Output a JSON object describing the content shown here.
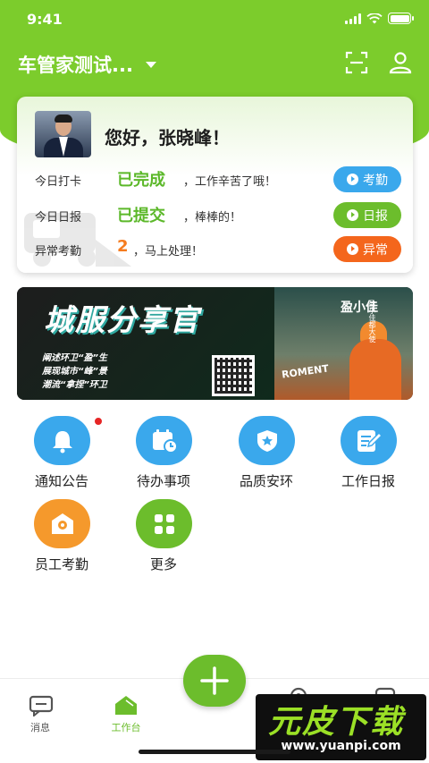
{
  "status_bar": {
    "time": "9:41"
  },
  "header": {
    "company": "车管家测试..."
  },
  "card": {
    "greeting": "您好，张晓峰！",
    "rows": [
      {
        "label": "今日打卡",
        "value": "已完成",
        "note": "，工作辛苦了哦！",
        "button": "考勤",
        "color": "#3aa8ec"
      },
      {
        "label": "今日日报",
        "value": "已提交",
        "note": "，棒棒的！",
        "button": "日报",
        "color": "#6cbd2c"
      },
      {
        "label": "异常考勤",
        "value": "2",
        "note": "，马上处理！",
        "button": "异常",
        "color": "#f4661c"
      }
    ]
  },
  "banner": {
    "title": "城服分享官",
    "bullets": [
      "阐述环卫“盈”生",
      "展现城市“峰”景",
      "潮流“拿捏”环卫"
    ],
    "name": "盈小佳",
    "sub": "盈小佳都大使",
    "brand": "ROMENT"
  },
  "grid": [
    {
      "label": "通知公告",
      "icon": "bell-icon",
      "color": "#3aa8ec",
      "badge": true
    },
    {
      "label": "待办事项",
      "icon": "calendar-clock-icon",
      "color": "#3aa8ec"
    },
    {
      "label": "品质安环",
      "icon": "shield-star-icon",
      "color": "#3aa8ec"
    },
    {
      "label": "工作日报",
      "icon": "edit-report-icon",
      "color": "#3aa8ec"
    },
    {
      "label": "员工考勤",
      "icon": "location-pin-icon",
      "color": "#f5992c"
    },
    {
      "label": "更多",
      "icon": "apps-grid-icon",
      "color": "#6cbd2c"
    }
  ],
  "tabbar": {
    "tabs": [
      {
        "label": "消息",
        "icon": "message-icon",
        "active": false
      },
      {
        "label": "工作台",
        "icon": "workbench-icon",
        "active": true
      }
    ]
  },
  "watermark": {
    "title": "元皮下载",
    "url": "www.yuanpi.com"
  }
}
